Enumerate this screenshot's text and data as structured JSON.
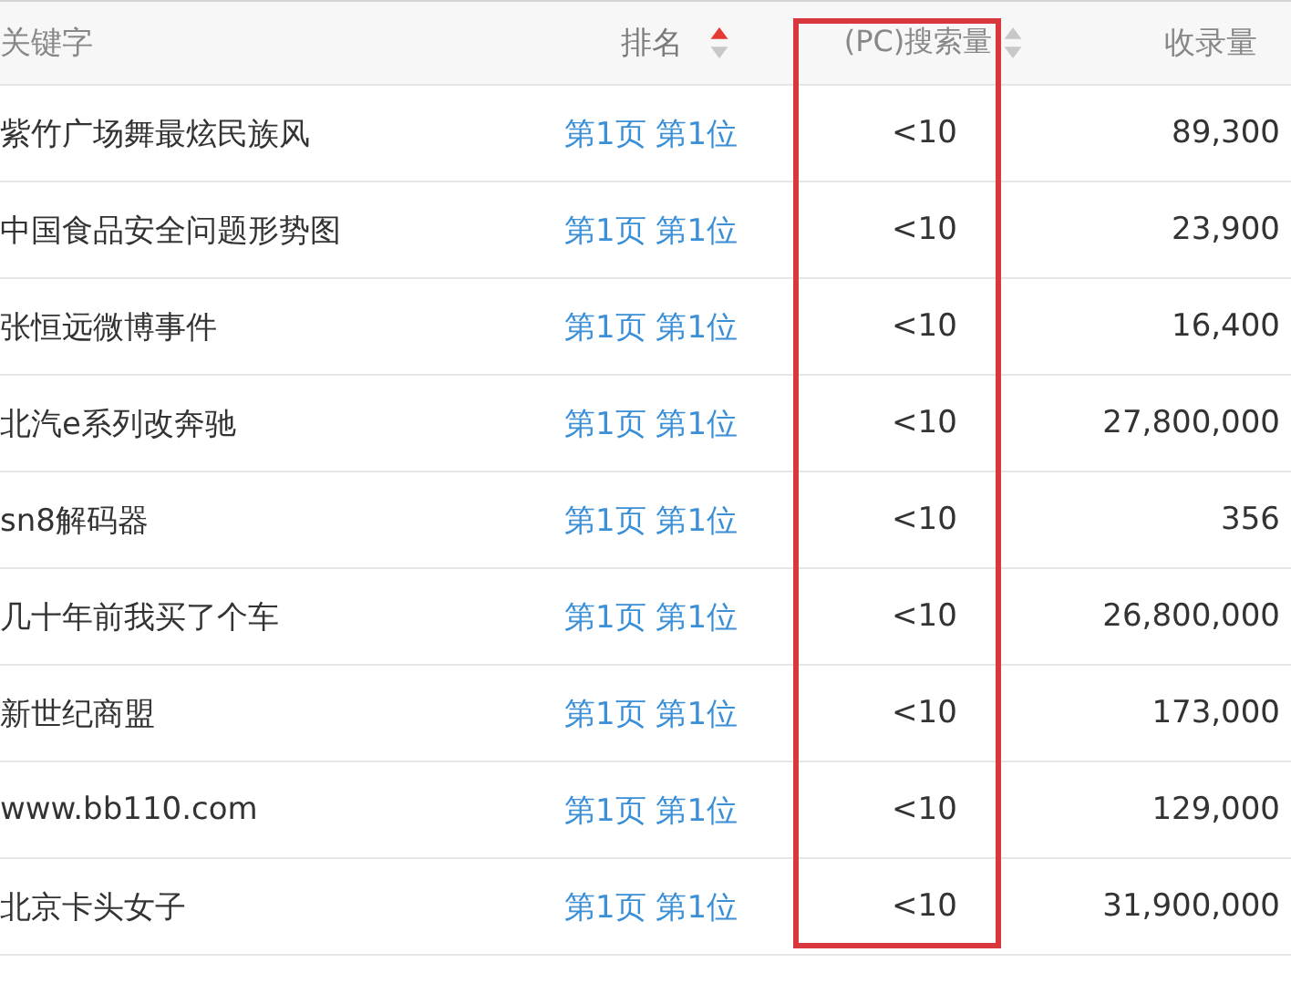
{
  "columns": [
    {
      "label": "关键字",
      "sortable": false,
      "sorted_ascending": false,
      "highlighted": false
    },
    {
      "label": "排名",
      "sortable": true,
      "sorted_ascending": true,
      "highlighted": false
    },
    {
      "label": "(PC)搜索量",
      "sortable": true,
      "sorted_ascending": false,
      "highlighted": true
    },
    {
      "label": "收录量",
      "sortable": false,
      "sorted_ascending": false,
      "highlighted": false
    }
  ],
  "rows": [
    {
      "keyword": "紫竹广场舞最炫民族风",
      "rank": "第1页 第1位",
      "pc_search": "<10",
      "indexed": "89,300"
    },
    {
      "keyword": "中国食品安全问题形势图",
      "rank": "第1页 第1位",
      "pc_search": "<10",
      "indexed": "23,900"
    },
    {
      "keyword": "张恒远微博事件",
      "rank": "第1页 第1位",
      "pc_search": "<10",
      "indexed": "16,400"
    },
    {
      "keyword": "北汽e系列改奔驰",
      "rank": "第1页 第1位",
      "pc_search": "<10",
      "indexed": "27,800,000"
    },
    {
      "keyword": "sn8解码器",
      "rank": "第1页 第1位",
      "pc_search": "<10",
      "indexed": "356"
    },
    {
      "keyword": "几十年前我买了个车",
      "rank": "第1页 第1位",
      "pc_search": "<10",
      "indexed": "26,800,000"
    },
    {
      "keyword": "新世纪商盟",
      "rank": "第1页 第1位",
      "pc_search": "<10",
      "indexed": "173,000"
    },
    {
      "keyword": "www.bb110.com",
      "rank": "第1页 第1位",
      "pc_search": "<10",
      "indexed": "129,000"
    },
    {
      "keyword": "北京卡头女子",
      "rank": "第1页 第1位",
      "pc_search": "<10",
      "indexed": "31,900,000"
    }
  ]
}
